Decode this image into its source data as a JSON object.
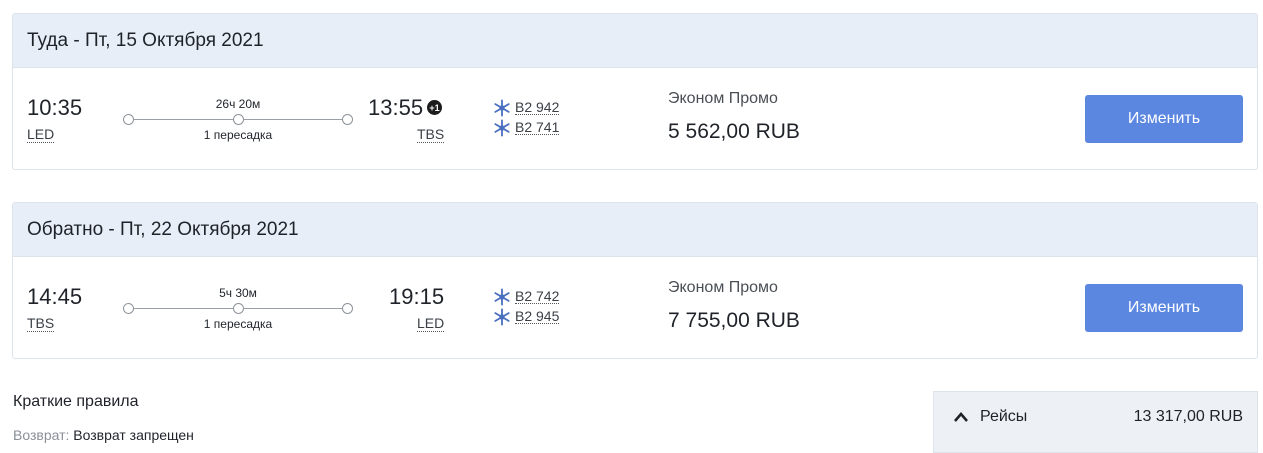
{
  "outbound": {
    "heading": "Туда - Пт, 15 Октября 2021",
    "dep_time": "10:35",
    "dep_code": "LED",
    "duration": "26ч 20м",
    "stops": "1 пересадка",
    "arr_time": "13:55",
    "day_offset": "+1",
    "arr_code": "TBS",
    "flights": [
      "B2 942",
      "B2 741"
    ],
    "fare_class": "Эконом Промо",
    "price": "5 562,00 RUB",
    "change_label": "Изменить"
  },
  "inbound": {
    "heading": "Обратно - Пт, 22 Октября 2021",
    "dep_time": "14:45",
    "dep_code": "TBS",
    "duration": "5ч 30м",
    "stops": "1 пересадка",
    "arr_time": "19:15",
    "arr_code": "LED",
    "flights": [
      "B2 742",
      "B2 945"
    ],
    "fare_class": "Эконом Промо",
    "price": "7 755,00 RUB",
    "change_label": "Изменить"
  },
  "rules": {
    "title": "Краткие правила",
    "refund_label": "Возврат:",
    "refund_value": "Возврат запрещен"
  },
  "summary": {
    "label": "Рейсы",
    "total": "13 317,00 RUB"
  },
  "icons": {
    "airline": "belavia-snowflake-icon",
    "toggle": "chevron-up-icon"
  },
  "colors": {
    "accent": "#5b87e0",
    "header_bg": "#e8eef8",
    "airline_icon": "#4a6fbf"
  }
}
